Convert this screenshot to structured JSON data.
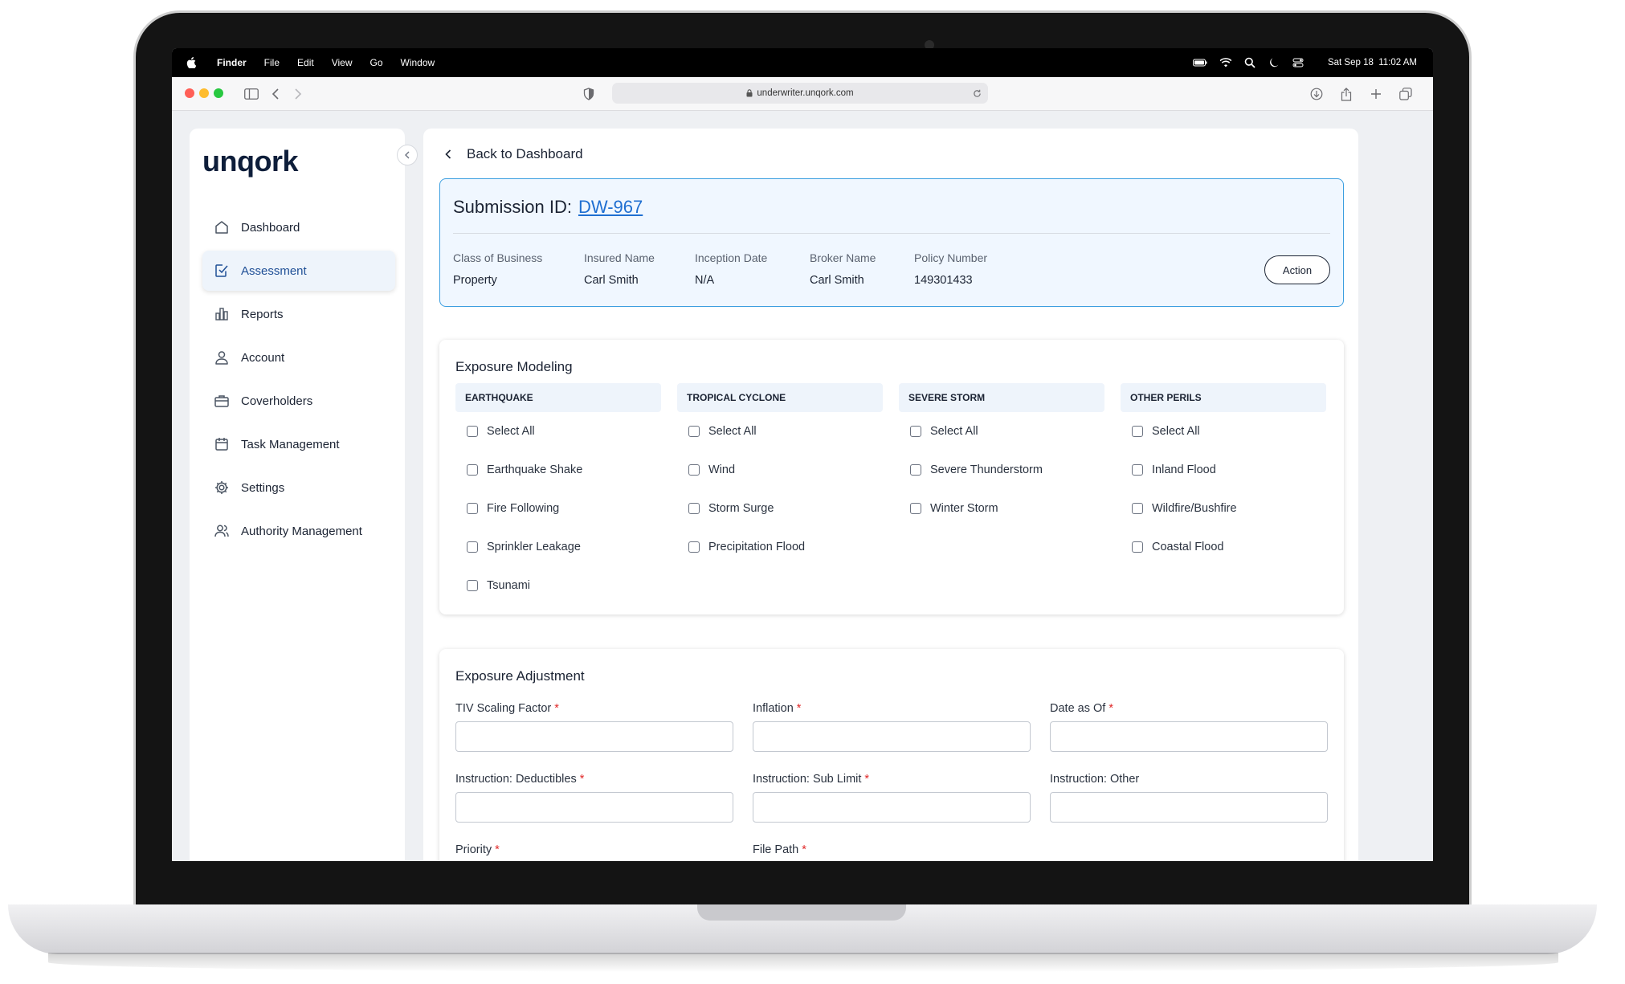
{
  "menubar": {
    "app_name": "Finder",
    "menus": [
      "File",
      "Edit",
      "View",
      "Go",
      "Window"
    ],
    "clock": "Sat Sep 18  11:02 AM"
  },
  "browser": {
    "url": "underwriter.unqork.com"
  },
  "sidebar": {
    "logo": "unqork",
    "items": [
      {
        "label": "Dashboard",
        "icon": "home-icon"
      },
      {
        "label": "Assessment",
        "icon": "clipboard-check-icon",
        "active": true
      },
      {
        "label": "Reports",
        "icon": "bar-chart-icon"
      },
      {
        "label": "Account",
        "icon": "user-icon"
      },
      {
        "label": "Coverholders",
        "icon": "briefcase-icon"
      },
      {
        "label": "Task Management",
        "icon": "calendar-icon"
      },
      {
        "label": "Settings",
        "icon": "gear-icon"
      },
      {
        "label": "Authority Management",
        "icon": "users-icon"
      }
    ]
  },
  "main": {
    "back_label": "Back to Dashboard",
    "submission": {
      "title_label": "Submission ID:",
      "id": "DW-967",
      "fields": [
        {
          "label": "Class of Business",
          "value": "Property"
        },
        {
          "label": "Insured Name",
          "value": "Carl Smith"
        },
        {
          "label": "Inception Date",
          "value": "N/A"
        },
        {
          "label": "Broker Name",
          "value": "Carl Smith"
        },
        {
          "label": "Policy Number",
          "value": "149301433"
        }
      ],
      "action_label": "Action"
    },
    "exposure_modeling": {
      "title": "Exposure Modeling",
      "columns": [
        {
          "header": "EARTHQUAKE",
          "items": [
            "Select All",
            "Earthquake Shake",
            "Fire Following",
            "Sprinkler Leakage",
            "Tsunami"
          ]
        },
        {
          "header": "TROPICAL CYCLONE",
          "items": [
            "Select All",
            "Wind",
            "Storm Surge",
            "Precipitation Flood"
          ]
        },
        {
          "header": "SEVERE STORM",
          "items": [
            "Select All",
            "Severe Thunderstorm",
            "Winter Storm"
          ]
        },
        {
          "header": "OTHER PERILS",
          "items": [
            "Select All",
            "Inland Flood",
            "Wildfire/Bushfire",
            "Coastal Flood"
          ]
        }
      ]
    },
    "exposure_adjustment": {
      "title": "Exposure Adjustment",
      "fields": [
        {
          "label": "TIV Scaling Factor",
          "required": "*",
          "value": ""
        },
        {
          "label": "Inflation",
          "required": "*",
          "value": ""
        },
        {
          "label": "Date as Of",
          "required": "*",
          "value": ""
        },
        {
          "label": "Instruction: Deductibles",
          "required": "*",
          "value": ""
        },
        {
          "label": "Instruction: Sub Limit",
          "required": "*",
          "value": ""
        },
        {
          "label": "Instruction: Other",
          "required": "",
          "value": ""
        },
        {
          "label": "Priority",
          "required": "*",
          "value": ""
        },
        {
          "label": "File Path",
          "required": "*",
          "value": ""
        }
      ]
    }
  },
  "colors": {
    "accent": "#1f6fd1",
    "active_bg": "#eef4fb",
    "required": "#e02828",
    "traffic_red": "#ff5f57",
    "traffic_yellow": "#febc2e",
    "traffic_green": "#28c840"
  }
}
